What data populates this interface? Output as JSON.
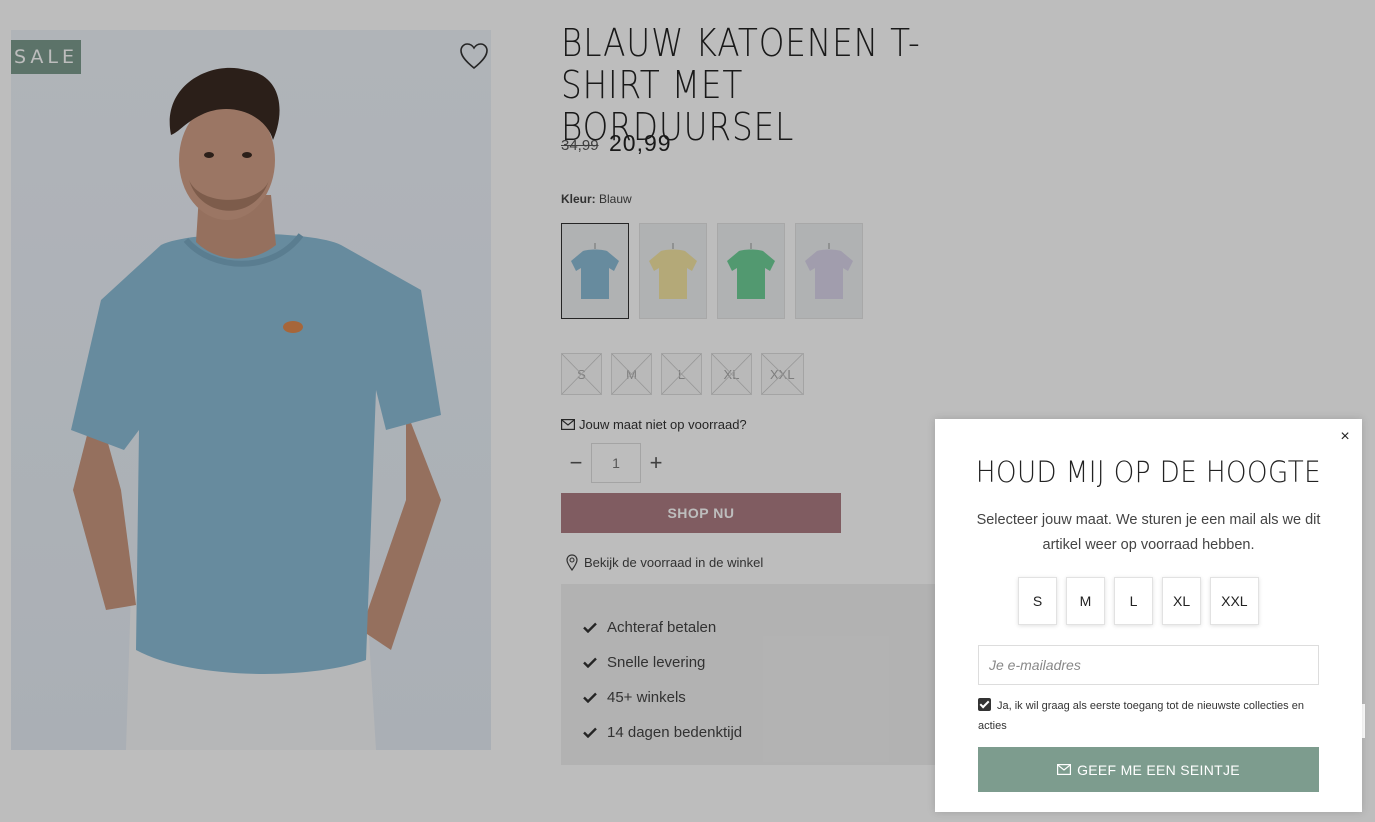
{
  "product": {
    "badge": "SALE",
    "title": "BLAUW KATOENEN T-SHIRT MET BORDUURSEL",
    "price_old": "34,99",
    "price_new": "20,99",
    "color_label": "Kleur:",
    "color_value": "Blauw",
    "swatches": [
      {
        "color": "#8cbcd5",
        "selected": true
      },
      {
        "color": "#f3e4a3",
        "selected": false
      },
      {
        "color": "#6fcf97",
        "selected": false
      },
      {
        "color": "#d9d4ea",
        "selected": false
      }
    ],
    "sizes": [
      "S",
      "M",
      "L",
      "XL",
      "XXL"
    ],
    "stock_link": "Jouw maat niet op voorraad?",
    "quantity": "1",
    "shop_button": "SHOP NU",
    "store_link": "Bekijk de voorraad in de winkel",
    "usps": [
      "Achteraf betalen",
      "Snelle levering",
      "45+ winkels",
      "14 dagen bedenktijd"
    ]
  },
  "popup": {
    "title": "HOUD MIJ OP DE HOOGTE",
    "text": "Selecteer jouw maat. We sturen je een mail als we dit artikel weer op voorraad hebben.",
    "sizes": [
      "S",
      "M",
      "L",
      "XL",
      "XXL"
    ],
    "email_placeholder": "Je e-mailadres",
    "consent": "Ja, ik wil graag als eerste toegang tot de nieuwste collecties en acties",
    "consent_checked": true,
    "button": "GEEF ME EEN SEINTJE",
    "close": "×"
  },
  "colors": {
    "sale_badge": "#7d9c8e",
    "shop_button": "#ad7d83",
    "notify_button": "#7d9c8e"
  }
}
